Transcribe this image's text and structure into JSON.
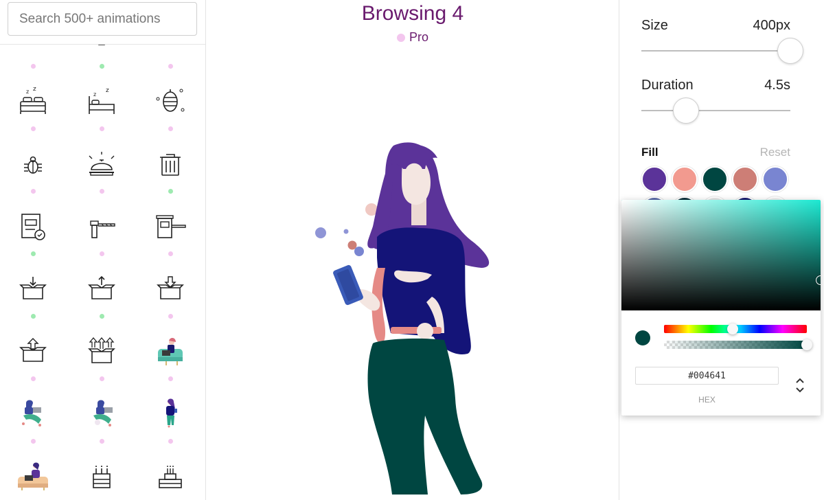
{
  "search": {
    "placeholder": "Search 500+ animations"
  },
  "icons": [
    {
      "name": "tray-icon",
      "dot": "#f3c6ee"
    },
    {
      "name": "monitor-icon",
      "dot": "#9eeab0"
    },
    {
      "name": "plant-icon",
      "dot": "#f3c6ee"
    },
    {
      "name": "double-bed-sleep-icon",
      "dot": "#f3c6ee"
    },
    {
      "name": "single-bed-sleep-icon",
      "dot": "#f3c6ee"
    },
    {
      "name": "beehive-icon",
      "dot": "#f3c6ee"
    },
    {
      "name": "bug-icon",
      "dot": "#f3c6ee"
    },
    {
      "name": "service-bell-icon",
      "dot": "#f3c6ee"
    },
    {
      "name": "trash-can-icon",
      "dot": "#9eeab0"
    },
    {
      "name": "approved-document-icon",
      "dot": "#9eeab0"
    },
    {
      "name": "barrier-gate-icon",
      "dot": "#f3c6ee"
    },
    {
      "name": "toll-booth-icon",
      "dot": "#f3c6ee"
    },
    {
      "name": "box-arrow-in-icon",
      "dot": "#9eeab0"
    },
    {
      "name": "box-arrow-out-icon",
      "dot": "#9eeab0"
    },
    {
      "name": "box-download-icon",
      "dot": "#f3c6ee"
    },
    {
      "name": "box-upload-icon",
      "dot": "#f3c6ee"
    },
    {
      "name": "box-multi-upload-icon",
      "dot": "#f3c6ee"
    },
    {
      "name": "woman-armchair-laptop-icon",
      "dot": "#f3c6ee"
    },
    {
      "name": "woman-sitting-laptop-icon",
      "dot": "#f3c6ee"
    },
    {
      "name": "woman-sitting-laptop-2-icon",
      "dot": "#f3c6ee"
    },
    {
      "name": "woman-standing-phone-icon",
      "dot": "#f3c6ee"
    },
    {
      "name": "woman-sofa-laptop-icon",
      "dot": "#f3c6ee"
    },
    {
      "name": "birthday-cake-icon",
      "dot": "#f3c6ee"
    },
    {
      "name": "two-tier-cake-icon",
      "dot": "#f3c6ee"
    }
  ],
  "preview": {
    "title": "Browsing 4",
    "badge": "Pro",
    "badge_color": "#f3c6ee"
  },
  "controls": {
    "size": {
      "label": "Size",
      "value": "400px",
      "level": 1.0
    },
    "duration": {
      "label": "Duration",
      "value": "4.5s",
      "level": 0.3
    },
    "fill": {
      "label": "Fill",
      "reset": "Reset"
    }
  },
  "palette": [
    "#5b3399",
    "#f29a8f",
    "#004641",
    "#cd7e76",
    "#7985d1"
  ],
  "palette_partial": [
    "#5b6aa8",
    "#0d2f3a",
    "#e6e6e6",
    "#1a1a6e",
    "#f0f0f0"
  ],
  "picker": {
    "hex": "#004641",
    "mode_label": "HEX",
    "hue_color": "#1de9d2",
    "hue_level": 0.48,
    "alpha_level": 1.0
  }
}
